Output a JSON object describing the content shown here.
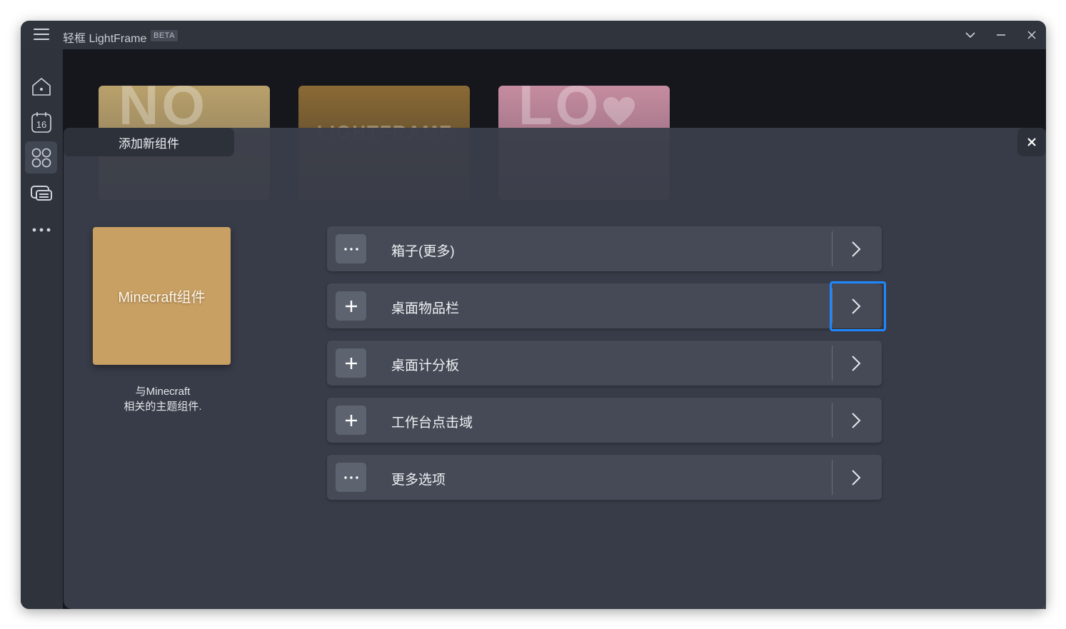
{
  "titlebar": {
    "app_name": "轻框 LightFrame",
    "badge": "BETA",
    "icons": [
      "hamburger-menu-icon",
      "chevron-down-icon",
      "minimize-icon",
      "close-icon"
    ]
  },
  "sidebar": {
    "items": [
      {
        "icon": "home-icon"
      },
      {
        "icon": "calendar-icon",
        "date": "16"
      },
      {
        "icon": "widgets-icon",
        "active": true
      },
      {
        "icon": "cards-icon"
      },
      {
        "icon": "more-icon"
      }
    ]
  },
  "background_cards": [
    {
      "text": "NO",
      "color": "#b9a16b"
    },
    {
      "text": "LIGHTFRAME",
      "color": "#8a6a35"
    },
    {
      "text": "LO",
      "color": "#c68ca0"
    }
  ],
  "panel": {
    "title": "添加新组件",
    "preview": {
      "label": "Minecraft组件",
      "color": "#c9a063"
    },
    "description_line1": "与Minecraft",
    "description_line2": "相关的主题组件.",
    "rows": [
      {
        "label": "箱子(更多)",
        "icon": "ellipsis-icon"
      },
      {
        "label": "桌面物品栏",
        "icon": "plus-icon",
        "focused": true
      },
      {
        "label": "桌面计分板",
        "icon": "plus-icon"
      },
      {
        "label": "工作台点击域",
        "icon": "plus-icon"
      },
      {
        "label": "更多选项",
        "icon": "ellipsis-icon"
      }
    ]
  },
  "colors": {
    "accent_focus": "#1e88ff",
    "panel_bg": "#3a3e4a",
    "row_bg": "#454a56"
  }
}
